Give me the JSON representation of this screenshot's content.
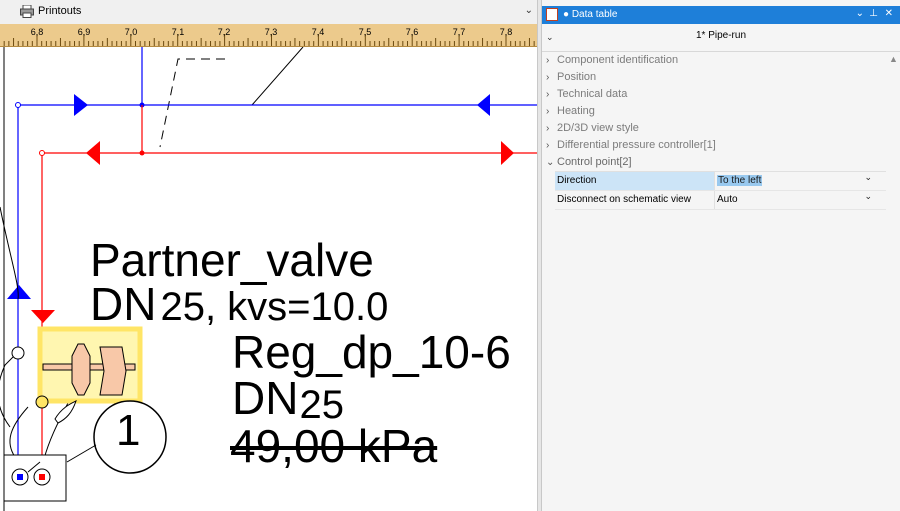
{
  "printouts": {
    "title": "Printouts",
    "icon": "printer-icon"
  },
  "ruler": {
    "ticks": [
      "6,8",
      "6,9",
      "7,0",
      "7,1",
      "7,2",
      "7,3",
      "7,4",
      "7,5",
      "7,6",
      "7,7",
      "7,8"
    ]
  },
  "canvas": {
    "valve_label": "Partner_valve",
    "valve_dn_prefix": "DN",
    "valve_dn_rest": "25, kvs=10.0",
    "reg_label": "Reg_dp_10-6",
    "reg_dn_prefix": "DN",
    "reg_dn_value": "25",
    "pressure": "49,00 kPa",
    "circle_number": "1"
  },
  "data_table": {
    "title": "Data table",
    "pipe_run": "1* Pipe-run",
    "categories": [
      {
        "label": "Component identification",
        "expanded": false
      },
      {
        "label": "Position",
        "expanded": false
      },
      {
        "label": "Technical data",
        "expanded": false
      },
      {
        "label": "Heating",
        "expanded": false
      },
      {
        "label": "2D/3D view style",
        "expanded": false
      },
      {
        "label": "Differential pressure controller[1]",
        "expanded": false
      },
      {
        "label": "Control point[2]",
        "expanded": true
      }
    ],
    "properties": [
      {
        "key": "Direction",
        "value": "To the left",
        "selected": true
      },
      {
        "key": "Disconnect on schematic view",
        "value": "Auto",
        "selected": false
      }
    ]
  },
  "colors": {
    "title_bar": "#1e7fd9",
    "supply": "#0000ff",
    "return": "#ff0000",
    "ruler": "#ecca8c",
    "valve_fill": "#f8c8a8",
    "highlight": "#ffe566"
  }
}
